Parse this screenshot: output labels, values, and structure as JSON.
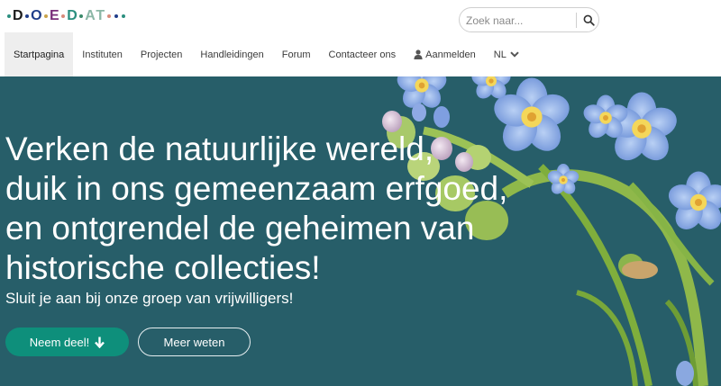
{
  "brand": {
    "logo_letters": [
      "D",
      "O",
      "E",
      "D",
      "A",
      "T"
    ],
    "colors": [
      "#1b1b1b",
      "#7a2f7a",
      "#2b8f7f",
      "#1f3d8a",
      "#8bb7a6",
      "#d88a7a",
      "#3a8a6a",
      "#c9a34a"
    ]
  },
  "search": {
    "placeholder": "Zoek naar...",
    "icon": "search-icon"
  },
  "nav": {
    "items": [
      {
        "label": "Startpagina",
        "active": true
      },
      {
        "label": "Instituten"
      },
      {
        "label": "Projecten"
      },
      {
        "label": "Handleidingen"
      },
      {
        "label": "Forum"
      },
      {
        "label": "Contacteer ons"
      },
      {
        "label": "Aanmelden",
        "icon": "user-icon"
      },
      {
        "label": "NL",
        "icon": "chevron-down-icon"
      }
    ]
  },
  "hero": {
    "headline_lines": [
      "Verken de natuurlijke wereld,",
      "duik in ons gemeenzaam erfgoed,",
      "en ontgrendel de geheimen van",
      "historische collecties!"
    ],
    "subline": "Sluit je aan bij onze groep van vrijwilligers!",
    "primary_button": "Neem deel!",
    "primary_button_icon": "arrow-down-icon",
    "secondary_button": "Meer weten",
    "background_color": "#275e69",
    "accent_color": "#0e8f7b",
    "image_subject": "forget-me-not-flowers"
  }
}
